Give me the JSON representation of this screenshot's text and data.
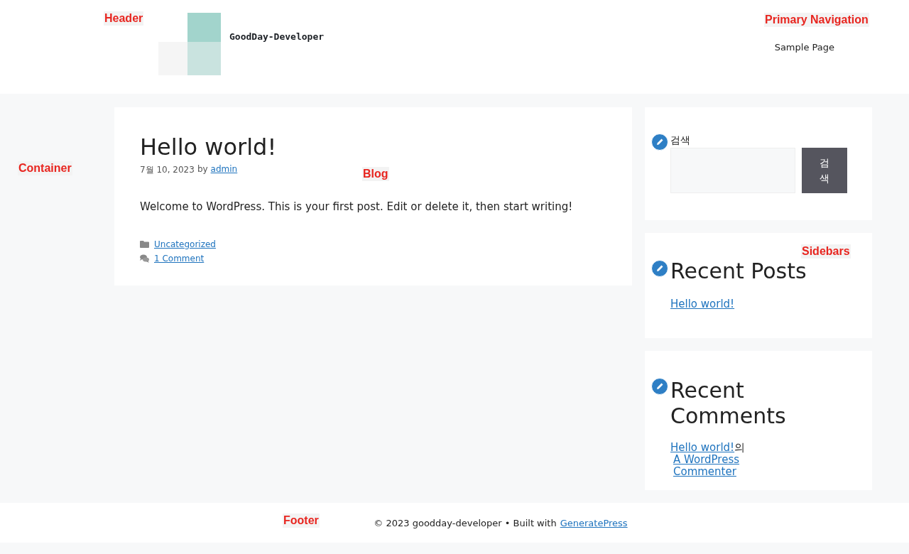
{
  "header": {
    "site_title": "GoodDay-Developer",
    "nav": [
      {
        "label": "Sample Page"
      }
    ]
  },
  "post": {
    "title": "Hello world!",
    "date": "7월 10, 2023",
    "by": "by",
    "author": "admin",
    "body": "Welcome to WordPress. This is your first post. Edit or delete it, then start writing!",
    "category": "Uncategorized",
    "comments": "1 Comment"
  },
  "sidebar": {
    "search": {
      "label": "검색",
      "button": "검색"
    },
    "recent_posts": {
      "title": "Recent Posts",
      "items": [
        "Hello world!"
      ]
    },
    "recent_comments": {
      "title": "Recent Comments",
      "post": "Hello world!",
      "of": "의",
      "author": "A WordPress Commenter"
    }
  },
  "footer": {
    "copyright": "© 2023 goodday-developer • Built with",
    "link": "GeneratePress"
  },
  "annotations": [
    "Header",
    "Primary Navigation",
    "Container",
    "Blog",
    "Sidebars",
    "Footer"
  ]
}
